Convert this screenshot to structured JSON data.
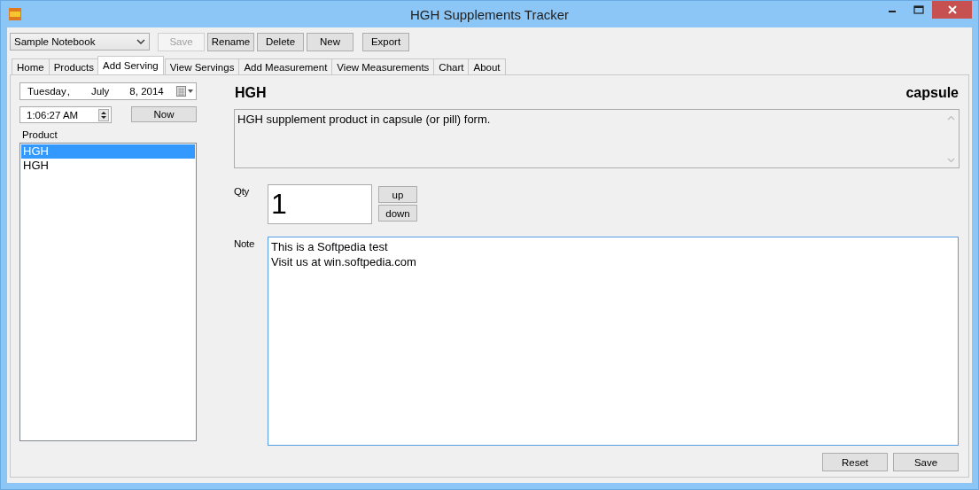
{
  "window": {
    "title": "HGH Supplements Tracker"
  },
  "toolbar": {
    "notebook": {
      "value": "Sample Notebook"
    },
    "buttons": [
      {
        "label": "Save",
        "disabled": true
      },
      {
        "label": "Rename",
        "disabled": false
      },
      {
        "label": "Delete",
        "disabled": false
      },
      {
        "label": "New",
        "disabled": false
      },
      {
        "label": "Export",
        "disabled": false
      }
    ]
  },
  "tabs": [
    {
      "label": "Home",
      "selected": false
    },
    {
      "label": "Products",
      "selected": false
    },
    {
      "label": "Add Serving",
      "selected": true
    },
    {
      "label": "View Servings",
      "selected": false
    },
    {
      "label": "Add Measurement",
      "selected": false
    },
    {
      "label": "View Measurements",
      "selected": false
    },
    {
      "label": "Chart",
      "selected": false
    },
    {
      "label": "About",
      "selected": false
    }
  ],
  "serving": {
    "date": {
      "weekday": "Tuesday",
      "sep1": ",",
      "month": "July",
      "day_year": "8, 2014"
    },
    "time": "1:06:27 AM",
    "now_button": "Now",
    "product_label": "Product",
    "products": [
      {
        "label": "HGH",
        "selected": true
      },
      {
        "label": "HGH",
        "selected": false
      }
    ],
    "product_name": "HGH",
    "product_form": "capsule",
    "description": "HGH supplement product in capsule (or pill) form.",
    "qty_label": "Qty",
    "qty": "1",
    "up_button": "up",
    "down_button": "down",
    "note_label": "Note",
    "note": "This is a Softpedia test\nVisit us at win.softpedia.com",
    "reset_button": "Reset",
    "save_button": "Save"
  }
}
